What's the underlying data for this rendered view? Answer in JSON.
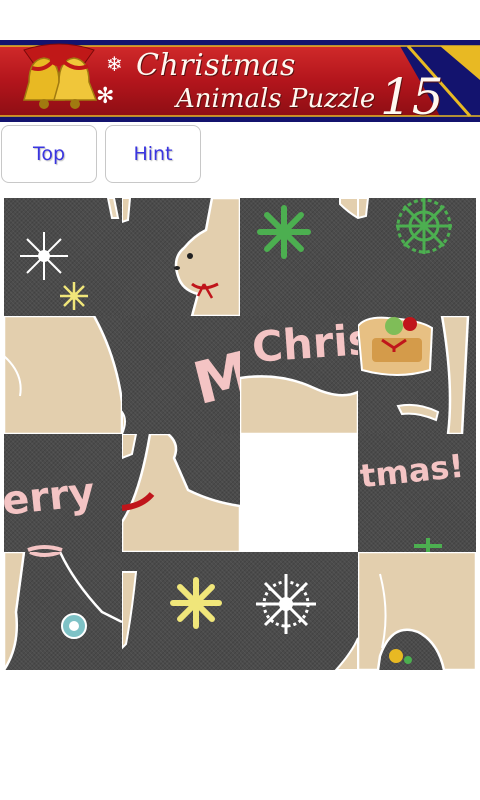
{
  "banner": {
    "title_line1": "Christmas",
    "title_line2": "Animals Puzzle",
    "level": "15",
    "colors": {
      "red": "#b3151c",
      "navy": "#13136e",
      "gold": "#e8b923"
    }
  },
  "buttons": {
    "top_label": "Top",
    "hint_label": "Hint"
  },
  "board": {
    "grid": "4x4",
    "empty_tile": {
      "row": 3,
      "col": 3
    },
    "tile_texts": {
      "christ": "Christ",
      "merry_m": "M",
      "erry": "erry",
      "tmas": "tmas!"
    }
  }
}
